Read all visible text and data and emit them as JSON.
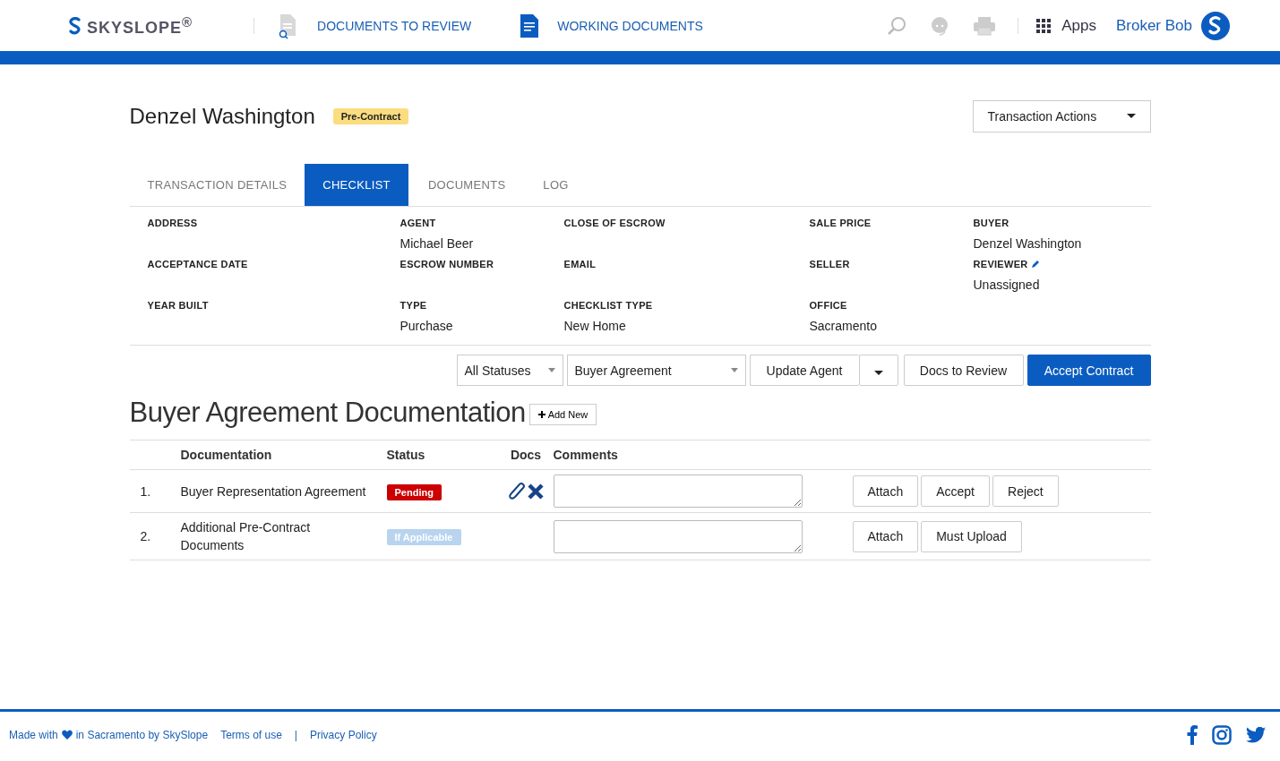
{
  "header": {
    "logo": "SKYSLOPE$^{®}$",
    "nav": [
      {
        "label": "DOCUMENTS TO REVIEW",
        "kind": "review"
      },
      {
        "label": "WORKING DOCUMENTS",
        "kind": "working"
      }
    ],
    "apps": "Apps",
    "user": "Broker Bob"
  },
  "title": "Denzel Washington",
  "badge": "Pre-Contract",
  "actions_menu": "Transaction Actions",
  "tabs": [
    {
      "label": "TRANSACTION DETAILS",
      "selected": false
    },
    {
      "label": "CHECKLIST",
      "selected": true
    },
    {
      "label": "DOCUMENTS",
      "selected": false
    },
    {
      "label": "LOG",
      "selected": false
    }
  ],
  "details": [
    [
      {
        "label": "ADDRESS",
        "editable": false
      },
      {
        "label": "AGENT",
        "value": "Michael Beer",
        "editable": false
      },
      {
        "label": "CLOSE OF ESCROW",
        "editable": false
      },
      {
        "label": "SALE PRICE",
        "editable": false
      },
      {
        "label": "BUYER",
        "value": "Denzel Washington",
        "editable": false
      }
    ],
    [
      {
        "label": "ACCEPTANCE DATE",
        "editable": false
      },
      {
        "label": "ESCROW NUMBER",
        "editable": false
      },
      {
        "label": "EMAIL",
        "editable": false
      },
      {
        "label": "SELLER",
        "editable": false
      },
      {
        "label": "REVIEWER",
        "value": "Unassigned",
        "editable": true
      }
    ],
    [
      {
        "label": "YEAR BUILT",
        "editable": false
      },
      {
        "label": "TYPE",
        "value": "Purchase",
        "editable": false
      },
      {
        "label": "CHECKLIST TYPE",
        "value": "New Home",
        "editable": false
      },
      {
        "label": "OFFICE",
        "value": "Sacramento",
        "editable": false
      }
    ]
  ],
  "toolbar": [
    {
      "kind": "select",
      "label": "All Statuses"
    },
    {
      "kind": "select",
      "label": "Buyer Agreement"
    },
    {
      "kind": "split",
      "label": "Update Agent"
    },
    {
      "kind": "button",
      "label": "Docs to Review"
    },
    {
      "kind": "primary",
      "label": "Accept Contract"
    }
  ],
  "section_title": "Buyer Agreement Documentation",
  "add_new": "Add New",
  "table": {
    "columns": [
      "Documentation",
      "Status",
      "Docs",
      "Comments"
    ],
    "rows": [
      {
        "number": "1.",
        "name": "Buyer Representation Agreement",
        "status": {
          "label": "Pending",
          "kind": "pending"
        },
        "has_docs": true,
        "actions": [
          "Attach",
          "Accept",
          "Reject"
        ]
      },
      {
        "number": "2.",
        "name": "Additional Pre-Contract Documents",
        "status": {
          "label": "If Applicable",
          "kind": "optional"
        },
        "has_docs": false,
        "actions": [
          "Attach",
          "Must Upload"
        ]
      }
    ]
  },
  "footer": {
    "made_with": "Made with",
    "made_in": "in Sacramento by SkySlope",
    "links": [
      "Terms of use",
      "Privacy Policy"
    ],
    "separator": "|"
  }
}
